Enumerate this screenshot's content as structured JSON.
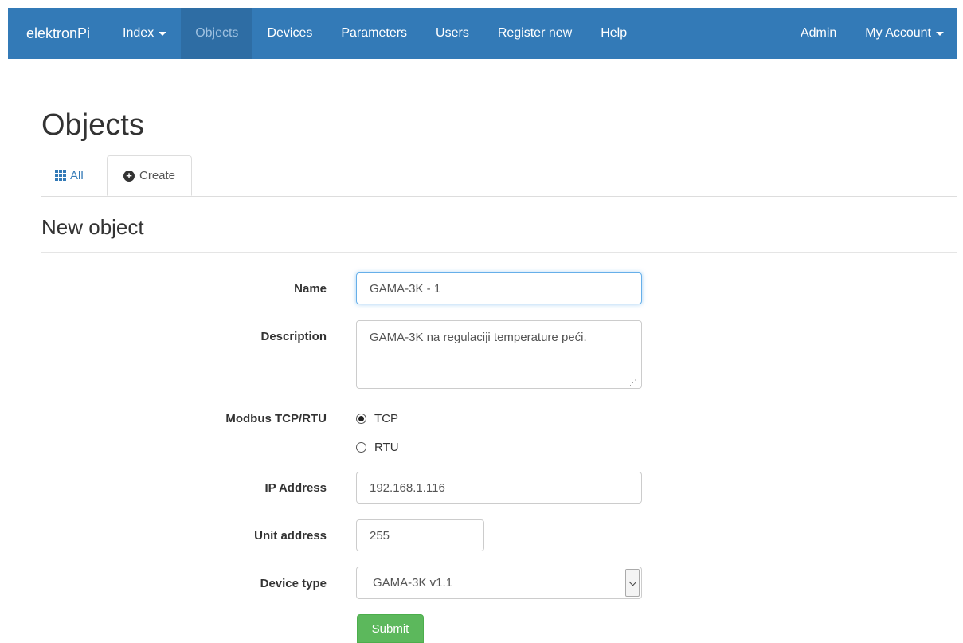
{
  "nav": {
    "brand": "elektronPi",
    "items": [
      "Index",
      "Objects",
      "Devices",
      "Parameters",
      "Users",
      "Register new",
      "Help"
    ],
    "right": [
      "Admin",
      "My Account"
    ],
    "active": "Objects",
    "bg_color": "#337ab7"
  },
  "page": {
    "title": "Objects"
  },
  "tabs": {
    "all": "All",
    "create": "Create"
  },
  "form": {
    "title": "New object",
    "name_label": "Name",
    "name_value": "GAMA-3K - 1",
    "description_label": "Description",
    "description_value": "GAMA-3K na regulaciji temperature peći.",
    "modbus_label": "Modbus TCP/RTU",
    "modbus_options": [
      "TCP",
      "RTU"
    ],
    "modbus_selected": "TCP",
    "ip_label": "IP Address",
    "ip_value": "192.168.1.116",
    "unit_label": "Unit address",
    "unit_value": "255",
    "device_label": "Device type",
    "device_value": "GAMA-3K v1.1",
    "submit_label": "Submit",
    "submit_color": "#5cb85c"
  },
  "icons": {
    "tab_all": "grid-icon",
    "tab_create": "plus-circle-icon",
    "caret": "caret-down-icon"
  }
}
